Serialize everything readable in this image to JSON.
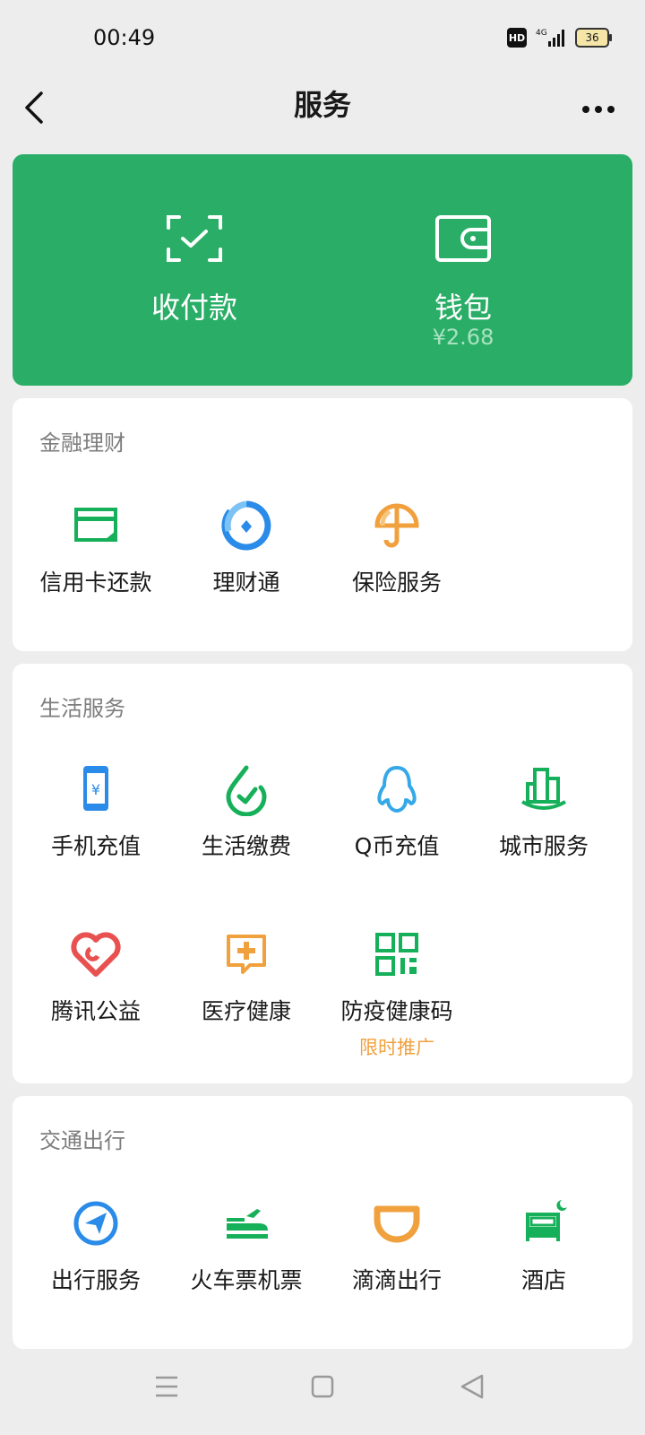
{
  "status": {
    "time": "00:49",
    "hd": "HD",
    "network": "4G",
    "battery": "36"
  },
  "nav": {
    "title": "服务"
  },
  "pay": {
    "collect_label": "收付款",
    "wallet_label": "钱包",
    "wallet_amount": "¥2.68"
  },
  "finance": {
    "title": "金融理财",
    "items": [
      {
        "label": "信用卡还款",
        "icon": "credit-card-icon"
      },
      {
        "label": "理财通",
        "icon": "wealth-icon"
      },
      {
        "label": "保险服务",
        "icon": "umbrella-icon"
      }
    ]
  },
  "life": {
    "title": "生活服务",
    "items": [
      {
        "label": "手机充值",
        "icon": "phone-topup-icon"
      },
      {
        "label": "生活缴费",
        "icon": "utility-bill-icon"
      },
      {
        "label": "Q币充值",
        "icon": "qq-penguin-icon"
      },
      {
        "label": "城市服务",
        "icon": "city-icon"
      },
      {
        "label": "腾讯公益",
        "icon": "charity-heart-icon"
      },
      {
        "label": "医疗健康",
        "icon": "medical-icon"
      },
      {
        "label": "防疫健康码",
        "icon": "qr-code-icon",
        "sub": "限时推广"
      }
    ]
  },
  "transport": {
    "title": "交通出行",
    "items": [
      {
        "label": "出行服务",
        "icon": "navigation-icon"
      },
      {
        "label": "火车票机票",
        "icon": "train-plane-icon"
      },
      {
        "label": "滴滴出行",
        "icon": "didi-icon"
      },
      {
        "label": "酒店",
        "icon": "hotel-bed-icon"
      }
    ]
  },
  "colors": {
    "green": "#2aae67",
    "blue": "#2a8be8",
    "orange": "#f0a03c",
    "red": "#e8514f",
    "qblue": "#35a8e8"
  }
}
